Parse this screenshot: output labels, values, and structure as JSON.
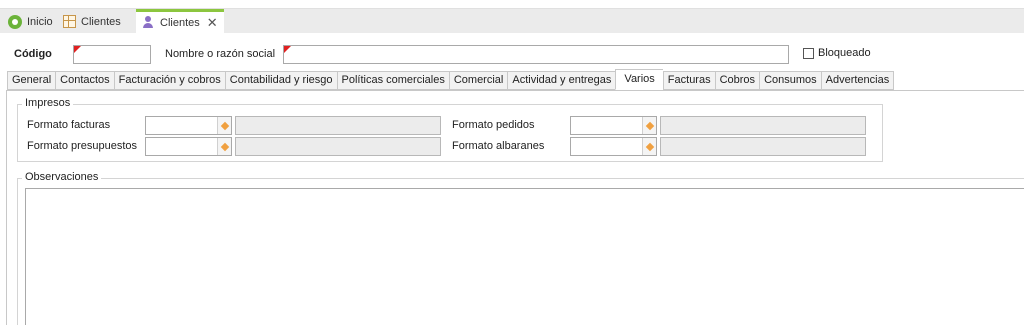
{
  "doc_tabs": [
    {
      "label": "Inicio",
      "icon": "home-icon"
    },
    {
      "label": "Clientes",
      "icon": "grid-icon"
    },
    {
      "label": "Clientes",
      "icon": "users-icon",
      "active": true,
      "closable": true
    }
  ],
  "header": {
    "codigo_label": "Código",
    "codigo_value": "",
    "nombre_label": "Nombre o razón social",
    "nombre_value": "",
    "bloqueado_label": "Bloqueado",
    "bloqueado_checked": false,
    "required_marker_color": "#e02020"
  },
  "section_tabs": [
    {
      "label": "General"
    },
    {
      "label": "Contactos"
    },
    {
      "label": "Facturación y cobros"
    },
    {
      "label": "Contabilidad y riesgo"
    },
    {
      "label": "Políticas comerciales"
    },
    {
      "label": "Comercial"
    },
    {
      "label": "Actividad y entregas"
    },
    {
      "label": "Varios",
      "active": true
    },
    {
      "label": "Facturas"
    },
    {
      "label": "Cobros"
    },
    {
      "label": "Consumos"
    },
    {
      "label": "Advertencias"
    }
  ],
  "impresos": {
    "title": "Impresos",
    "formato_facturas_label": "Formato facturas",
    "formato_presupuestos_label": "Formato presupuestos",
    "formato_pedidos_label": "Formato pedidos",
    "formato_albaranes_label": "Formato albaranes"
  },
  "observaciones": {
    "title": "Observaciones",
    "value": ""
  },
  "colors": {
    "active_tab_accent": "#8cc63f",
    "lookup_button": "#f0a040",
    "readonly_bg": "#ececec"
  }
}
